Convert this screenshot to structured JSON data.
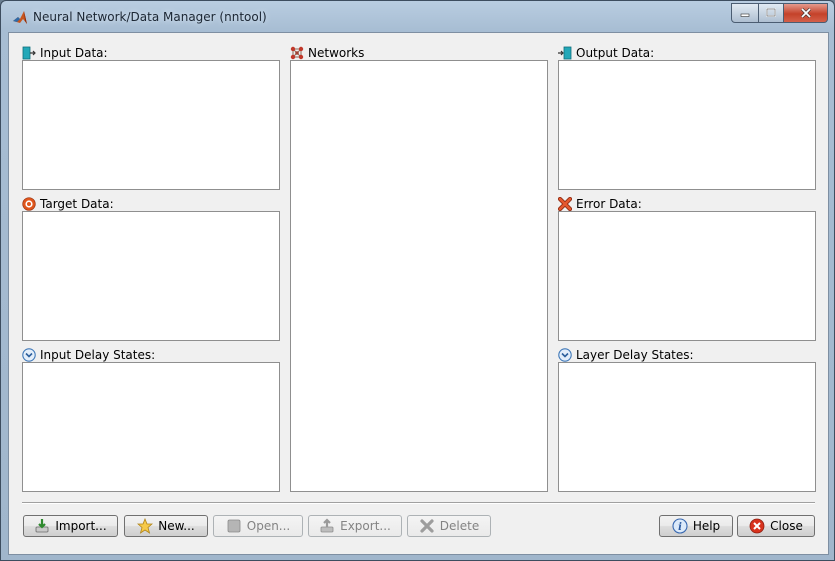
{
  "window": {
    "title": "Neural Network/Data Manager (nntool)"
  },
  "panels": {
    "input_data": "Input Data:",
    "target_data": "Target Data:",
    "input_delay_states": "Input Delay States:",
    "networks": "Networks",
    "output_data": "Output Data:",
    "error_data": "Error Data:",
    "layer_delay_states": "Layer Delay States:"
  },
  "buttons": {
    "import": "Import...",
    "new": "New...",
    "open": "Open...",
    "export": "Export...",
    "delete": "Delete",
    "help": "Help",
    "close": "Close"
  },
  "icons": {
    "input_data": "input-data-icon",
    "target_data": "target-icon",
    "delay_states": "chevron-down-circle-icon",
    "networks": "network-icon",
    "output_data": "output-data-icon",
    "error_data": "x-icon"
  }
}
